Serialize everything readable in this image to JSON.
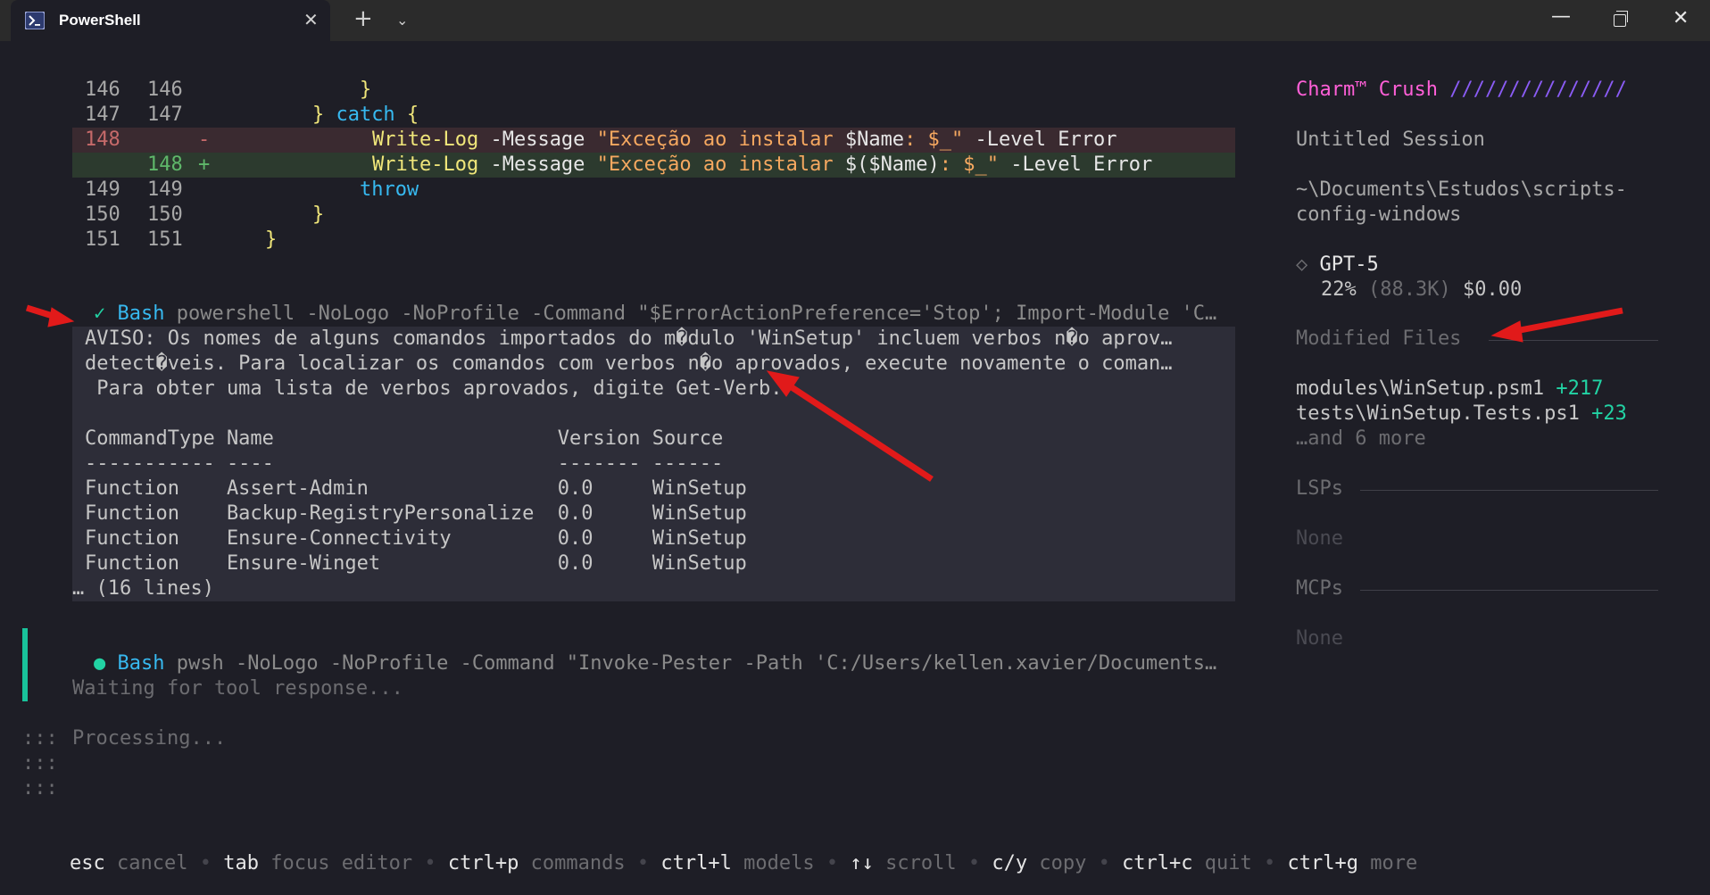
{
  "window": {
    "tab_title": "PowerShell",
    "tab_close": "✕",
    "new_tab": "+",
    "tab_dropdown": "⌄",
    "minimize": "—",
    "close": "✕"
  },
  "diff": [
    {
      "old": "146",
      "new": "146",
      "marker": "",
      "code": "            }"
    },
    {
      "old": "147",
      "new": "147",
      "marker": "",
      "code": "        } ",
      "kw": "catch",
      "tail": " {"
    },
    {
      "old": "148",
      "new": "",
      "marker": "-",
      "fn": "Write-Log",
      "param1": " -Message ",
      "str": "\"Exceção ao instalar ",
      "var": "$Name",
      "str2": ": $_\"",
      "param2": " -Level ",
      "val": "Error"
    },
    {
      "old": "",
      "new": "148",
      "marker": "+",
      "fn": "Write-Log",
      "param1": " -Message ",
      "str": "\"Exceção ao instalar ",
      "var": "$($Name)",
      "str2": ": $_\"",
      "param2": " -Level ",
      "val": "Error"
    },
    {
      "old": "149",
      "new": "149",
      "marker": "",
      "code": "            ",
      "kw": "throw"
    },
    {
      "old": "150",
      "new": "150",
      "marker": "",
      "code": "        }"
    },
    {
      "old": "151",
      "new": "151",
      "marker": "",
      "code": "    }"
    }
  ],
  "tool1": {
    "status_icon": "✓",
    "name": "Bash",
    "command": "powershell -NoLogo -NoProfile -Command \"$ErrorActionPreference='Stop'; Import-Module 'C…"
  },
  "output": {
    "lines": [
      "AVISO: Os nomes de alguns comandos importados do m�dulo 'WinSetup' incluem verbos n�o aprov…",
      "detect�veis. Para localizar os comandos com verbos n�o aprovados, execute novamente o coman…",
      " Para obter uma lista de verbos aprovados, digite Get-Verb.",
      "",
      "CommandType Name                        Version Source",
      "----------- ----                        ------- ------",
      "Function    Assert-Admin                0.0     WinSetup",
      "Function    Backup-RegistryPersonalize  0.0     WinSetup",
      "Function    Ensure-Connectivity         0.0     WinSetup",
      "Function    Ensure-Winget               0.0     WinSetup"
    ],
    "truncated": "… (16 lines)"
  },
  "tool2": {
    "status_icon": "●",
    "name": "Bash",
    "command": "pwsh -NoLogo -NoProfile -Command \"Invoke-Pester -Path 'C:/Users/kellen.xavier/Documents…",
    "waiting": "Waiting for tool response..."
  },
  "processing": {
    "spinner": [
      ":::",
      ":::",
      ":::"
    ],
    "label": "Processing..."
  },
  "shortcuts": [
    {
      "key": "esc",
      "action": "cancel"
    },
    {
      "key": "tab",
      "action": "focus editor"
    },
    {
      "key": "ctrl+p",
      "action": "commands"
    },
    {
      "key": "ctrl+l",
      "action": "models"
    },
    {
      "key": "↑↓",
      "action": "scroll"
    },
    {
      "key": "c/y",
      "action": "copy"
    },
    {
      "key": "ctrl+c",
      "action": "quit"
    },
    {
      "key": "ctrl+g",
      "action": "more"
    }
  ],
  "sidebar": {
    "brand": "Charm™ Crush",
    "brand_slashes": "///////////////",
    "session": "Untitled Session",
    "path_line1": "~\\Documents\\Estudos\\scripts-",
    "path_line2": "config-windows",
    "model_icon": "◇",
    "model": "GPT-5",
    "usage_percent": "22%",
    "usage_tokens": "(88.3K)",
    "usage_cost": "$0.00",
    "modified_title": "Modified Files",
    "files": [
      {
        "name": "modules\\WinSetup.psm1",
        "delta": "+217"
      },
      {
        "name": "tests\\WinSetup.Tests.ps1",
        "delta": "+23"
      }
    ],
    "more_files": "…and 6 more",
    "lsps_title": "LSPs",
    "lsps_value": "None",
    "mcps_title": "MCPs",
    "mcps_value": "None"
  },
  "colors": {
    "background": "#1e1e26",
    "brand_pink": "#ff5fd7",
    "brand_purple": "#8b5cf6",
    "accent_green": "#22d3a4",
    "annotation_red": "#e11a1a"
  }
}
